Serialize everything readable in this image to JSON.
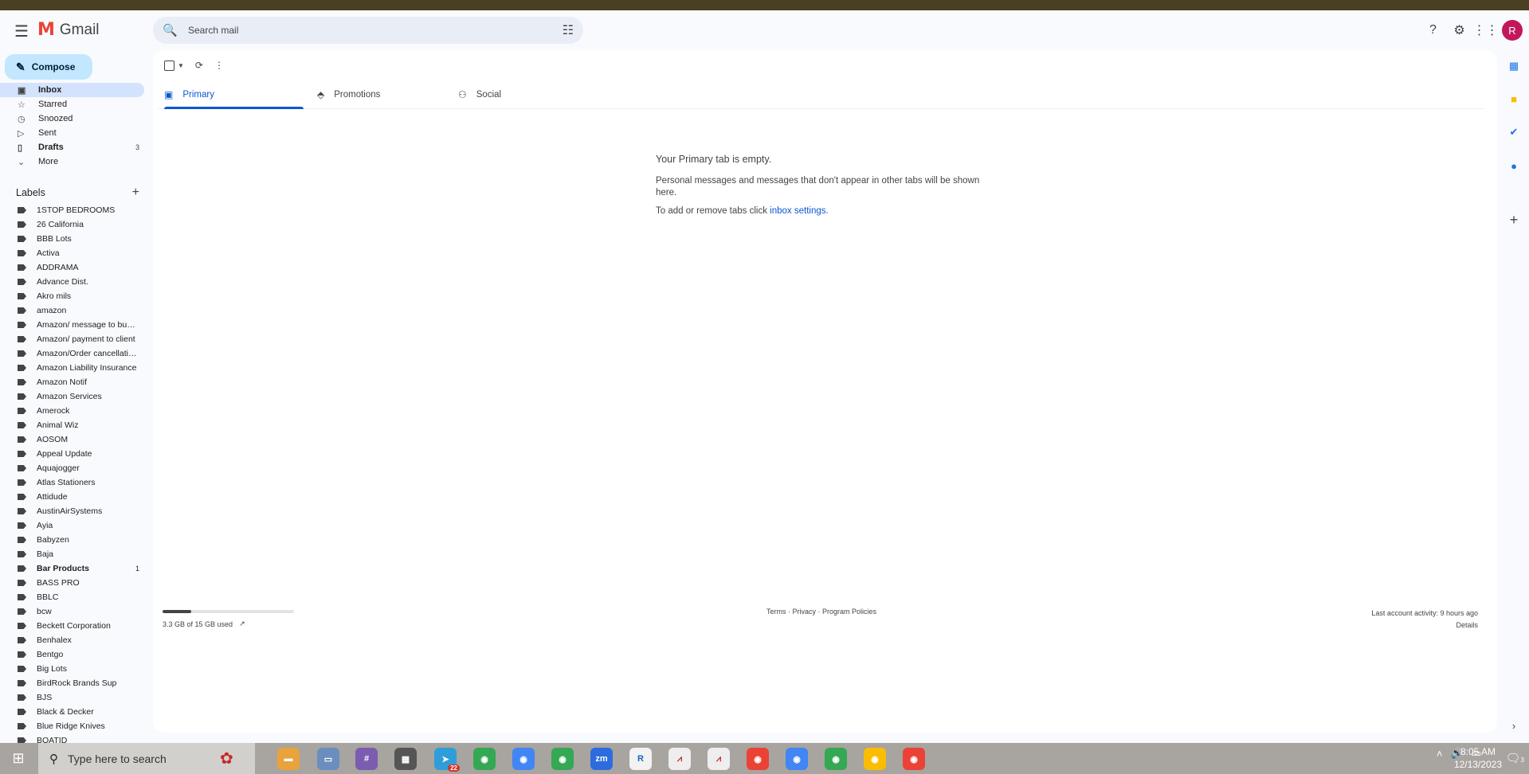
{
  "app": {
    "name": "Gmail"
  },
  "search": {
    "placeholder": "Search mail"
  },
  "header": {
    "avatar_letter": "R"
  },
  "compose": {
    "label": "Compose"
  },
  "nav": [
    {
      "label": "Inbox",
      "icon": "inbox-icon",
      "count": "",
      "active": true
    },
    {
      "label": "Starred",
      "icon": "star-icon",
      "count": ""
    },
    {
      "label": "Snoozed",
      "icon": "clock-icon",
      "count": ""
    },
    {
      "label": "Sent",
      "icon": "send-icon",
      "count": ""
    },
    {
      "label": "Drafts",
      "icon": "draft-icon",
      "count": "3",
      "bold": true
    },
    {
      "label": "More",
      "icon": "chevron-down-icon",
      "count": ""
    }
  ],
  "labels_title": "Labels",
  "labels": [
    {
      "name": "1STOP BEDROOMS"
    },
    {
      "name": "26 California"
    },
    {
      "name": "BBB Lots"
    },
    {
      "name": "Activa"
    },
    {
      "name": "ADDRAMA"
    },
    {
      "name": "Advance Dist."
    },
    {
      "name": "Akro mils"
    },
    {
      "name": "amazon"
    },
    {
      "name": "Amazon/ message to buyer"
    },
    {
      "name": "Amazon/ payment to client"
    },
    {
      "name": "Amazon/Order cancellation"
    },
    {
      "name": "Amazon Liability Insurance"
    },
    {
      "name": "Amazon Notif"
    },
    {
      "name": "Amazon Services"
    },
    {
      "name": "Amerock"
    },
    {
      "name": "Animal Wiz"
    },
    {
      "name": "AOSOM"
    },
    {
      "name": "Appeal Update"
    },
    {
      "name": "Aquajogger"
    },
    {
      "name": "Atlas Stationers"
    },
    {
      "name": "Attidude"
    },
    {
      "name": "AustinAirSystems"
    },
    {
      "name": "Ayia"
    },
    {
      "name": "Babyzen"
    },
    {
      "name": "Baja"
    },
    {
      "name": "Bar Products",
      "count": "1",
      "bold": true
    },
    {
      "name": "BASS PRO"
    },
    {
      "name": "BBLC"
    },
    {
      "name": "bcw"
    },
    {
      "name": "Beckett Corporation"
    },
    {
      "name": "Benhalex"
    },
    {
      "name": "Bentgo"
    },
    {
      "name": "Big Lots"
    },
    {
      "name": "BirdRock Brands Sup"
    },
    {
      "name": "BJS"
    },
    {
      "name": "Black & Decker"
    },
    {
      "name": "Blue Ridge Knives"
    },
    {
      "name": "BOATID"
    }
  ],
  "tabs": [
    {
      "label": "Primary",
      "icon": "inbox-icon",
      "active": true
    },
    {
      "label": "Promotions",
      "icon": "tag-icon"
    },
    {
      "label": "Social",
      "icon": "people-icon"
    }
  ],
  "empty": {
    "title": "Your Primary tab is empty.",
    "line1": "Personal messages and messages that don't appear in other tabs will be shown here.",
    "line2_prefix": "To add or remove tabs click ",
    "line2_link": "inbox settings",
    "line2_suffix": "."
  },
  "storage": {
    "text": "3.3 GB of 15 GB used",
    "used_fraction": 0.22
  },
  "footer": {
    "links": "Terms · Privacy · Program Policies",
    "activity": "Last account activity: 9 hours ago",
    "details": "Details"
  },
  "taskbar": {
    "search_placeholder": "Type here to search",
    "time": "8:05 AM",
    "date": "12/13/2023",
    "badge": "22",
    "notif_count": "3"
  }
}
